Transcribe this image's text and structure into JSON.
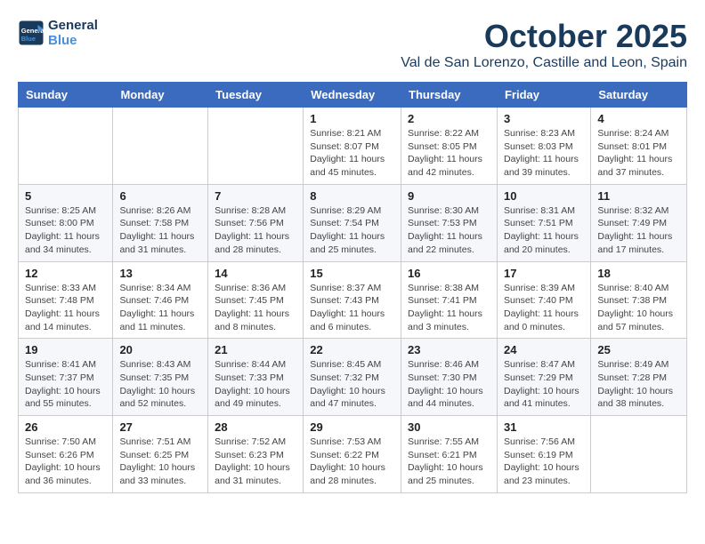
{
  "header": {
    "logo_line1": "General",
    "logo_line2": "Blue",
    "month_title": "October 2025",
    "location": "Val de San Lorenzo, Castille and Leon, Spain"
  },
  "weekdays": [
    "Sunday",
    "Monday",
    "Tuesday",
    "Wednesday",
    "Thursday",
    "Friday",
    "Saturday"
  ],
  "weeks": [
    [
      {
        "day": "",
        "sunrise": "",
        "sunset": "",
        "daylight": ""
      },
      {
        "day": "",
        "sunrise": "",
        "sunset": "",
        "daylight": ""
      },
      {
        "day": "",
        "sunrise": "",
        "sunset": "",
        "daylight": ""
      },
      {
        "day": "1",
        "sunrise": "Sunrise: 8:21 AM",
        "sunset": "Sunset: 8:07 PM",
        "daylight": "Daylight: 11 hours and 45 minutes."
      },
      {
        "day": "2",
        "sunrise": "Sunrise: 8:22 AM",
        "sunset": "Sunset: 8:05 PM",
        "daylight": "Daylight: 11 hours and 42 minutes."
      },
      {
        "day": "3",
        "sunrise": "Sunrise: 8:23 AM",
        "sunset": "Sunset: 8:03 PM",
        "daylight": "Daylight: 11 hours and 39 minutes."
      },
      {
        "day": "4",
        "sunrise": "Sunrise: 8:24 AM",
        "sunset": "Sunset: 8:01 PM",
        "daylight": "Daylight: 11 hours and 37 minutes."
      }
    ],
    [
      {
        "day": "5",
        "sunrise": "Sunrise: 8:25 AM",
        "sunset": "Sunset: 8:00 PM",
        "daylight": "Daylight: 11 hours and 34 minutes."
      },
      {
        "day": "6",
        "sunrise": "Sunrise: 8:26 AM",
        "sunset": "Sunset: 7:58 PM",
        "daylight": "Daylight: 11 hours and 31 minutes."
      },
      {
        "day": "7",
        "sunrise": "Sunrise: 8:28 AM",
        "sunset": "Sunset: 7:56 PM",
        "daylight": "Daylight: 11 hours and 28 minutes."
      },
      {
        "day": "8",
        "sunrise": "Sunrise: 8:29 AM",
        "sunset": "Sunset: 7:54 PM",
        "daylight": "Daylight: 11 hours and 25 minutes."
      },
      {
        "day": "9",
        "sunrise": "Sunrise: 8:30 AM",
        "sunset": "Sunset: 7:53 PM",
        "daylight": "Daylight: 11 hours and 22 minutes."
      },
      {
        "day": "10",
        "sunrise": "Sunrise: 8:31 AM",
        "sunset": "Sunset: 7:51 PM",
        "daylight": "Daylight: 11 hours and 20 minutes."
      },
      {
        "day": "11",
        "sunrise": "Sunrise: 8:32 AM",
        "sunset": "Sunset: 7:49 PM",
        "daylight": "Daylight: 11 hours and 17 minutes."
      }
    ],
    [
      {
        "day": "12",
        "sunrise": "Sunrise: 8:33 AM",
        "sunset": "Sunset: 7:48 PM",
        "daylight": "Daylight: 11 hours and 14 minutes."
      },
      {
        "day": "13",
        "sunrise": "Sunrise: 8:34 AM",
        "sunset": "Sunset: 7:46 PM",
        "daylight": "Daylight: 11 hours and 11 minutes."
      },
      {
        "day": "14",
        "sunrise": "Sunrise: 8:36 AM",
        "sunset": "Sunset: 7:45 PM",
        "daylight": "Daylight: 11 hours and 8 minutes."
      },
      {
        "day": "15",
        "sunrise": "Sunrise: 8:37 AM",
        "sunset": "Sunset: 7:43 PM",
        "daylight": "Daylight: 11 hours and 6 minutes."
      },
      {
        "day": "16",
        "sunrise": "Sunrise: 8:38 AM",
        "sunset": "Sunset: 7:41 PM",
        "daylight": "Daylight: 11 hours and 3 minutes."
      },
      {
        "day": "17",
        "sunrise": "Sunrise: 8:39 AM",
        "sunset": "Sunset: 7:40 PM",
        "daylight": "Daylight: 11 hours and 0 minutes."
      },
      {
        "day": "18",
        "sunrise": "Sunrise: 8:40 AM",
        "sunset": "Sunset: 7:38 PM",
        "daylight": "Daylight: 10 hours and 57 minutes."
      }
    ],
    [
      {
        "day": "19",
        "sunrise": "Sunrise: 8:41 AM",
        "sunset": "Sunset: 7:37 PM",
        "daylight": "Daylight: 10 hours and 55 minutes."
      },
      {
        "day": "20",
        "sunrise": "Sunrise: 8:43 AM",
        "sunset": "Sunset: 7:35 PM",
        "daylight": "Daylight: 10 hours and 52 minutes."
      },
      {
        "day": "21",
        "sunrise": "Sunrise: 8:44 AM",
        "sunset": "Sunset: 7:33 PM",
        "daylight": "Daylight: 10 hours and 49 minutes."
      },
      {
        "day": "22",
        "sunrise": "Sunrise: 8:45 AM",
        "sunset": "Sunset: 7:32 PM",
        "daylight": "Daylight: 10 hours and 47 minutes."
      },
      {
        "day": "23",
        "sunrise": "Sunrise: 8:46 AM",
        "sunset": "Sunset: 7:30 PM",
        "daylight": "Daylight: 10 hours and 44 minutes."
      },
      {
        "day": "24",
        "sunrise": "Sunrise: 8:47 AM",
        "sunset": "Sunset: 7:29 PM",
        "daylight": "Daylight: 10 hours and 41 minutes."
      },
      {
        "day": "25",
        "sunrise": "Sunrise: 8:49 AM",
        "sunset": "Sunset: 7:28 PM",
        "daylight": "Daylight: 10 hours and 38 minutes."
      }
    ],
    [
      {
        "day": "26",
        "sunrise": "Sunrise: 7:50 AM",
        "sunset": "Sunset: 6:26 PM",
        "daylight": "Daylight: 10 hours and 36 minutes."
      },
      {
        "day": "27",
        "sunrise": "Sunrise: 7:51 AM",
        "sunset": "Sunset: 6:25 PM",
        "daylight": "Daylight: 10 hours and 33 minutes."
      },
      {
        "day": "28",
        "sunrise": "Sunrise: 7:52 AM",
        "sunset": "Sunset: 6:23 PM",
        "daylight": "Daylight: 10 hours and 31 minutes."
      },
      {
        "day": "29",
        "sunrise": "Sunrise: 7:53 AM",
        "sunset": "Sunset: 6:22 PM",
        "daylight": "Daylight: 10 hours and 28 minutes."
      },
      {
        "day": "30",
        "sunrise": "Sunrise: 7:55 AM",
        "sunset": "Sunset: 6:21 PM",
        "daylight": "Daylight: 10 hours and 25 minutes."
      },
      {
        "day": "31",
        "sunrise": "Sunrise: 7:56 AM",
        "sunset": "Sunset: 6:19 PM",
        "daylight": "Daylight: 10 hours and 23 minutes."
      },
      {
        "day": "",
        "sunrise": "",
        "sunset": "",
        "daylight": ""
      }
    ]
  ]
}
